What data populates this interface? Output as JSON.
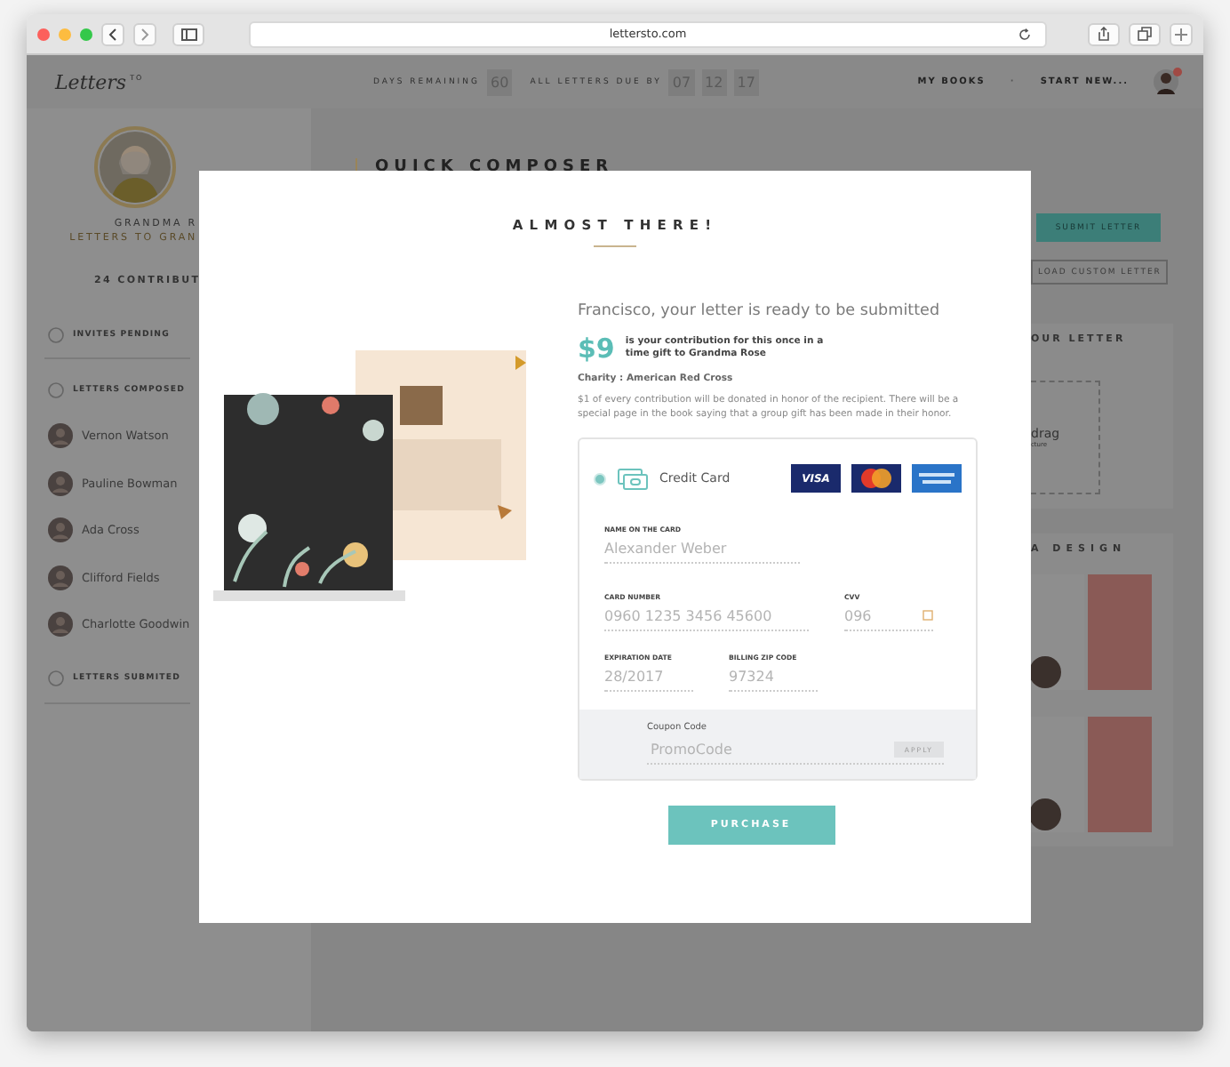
{
  "browser": {
    "url": "lettersto.com"
  },
  "header": {
    "logo": "Letters",
    "logo_suffix": "TO",
    "days_label": "DAYS REMAINING",
    "days": "60",
    "due_label": "ALL LETTERS DUE BY",
    "due": [
      "07",
      "12",
      "17"
    ],
    "nav": [
      "MY BOOKS",
      "·",
      "START NEW..."
    ]
  },
  "sidebar": {
    "name": "GRANDMA R",
    "subtitle": "LETTERS TO GRAN",
    "contributors": "24 CONTRIBUT",
    "sections": [
      {
        "label": "INVITES PENDING",
        "expanded": false
      },
      {
        "label": "LETTERS COMPOSED",
        "expanded": true,
        "children": [
          "Vernon Watson",
          "Pauline Bowman",
          "Ada Cross",
          "Clifford Fields",
          "Charlotte Goodwin"
        ]
      },
      {
        "label": "LETTERS SUBMITED",
        "expanded": false
      }
    ]
  },
  "composer": {
    "title": "QUICK COMPOSER"
  },
  "right_panel": {
    "submit": "SUBMIT LETTER",
    "load": "LOAD CUSTOM LETTER",
    "letter_title": "OUR LETTER",
    "drag_title": "drag",
    "drag_hint": "cture",
    "design_title": "A DESIGN"
  },
  "modal": {
    "title": "ALMOST THERE!",
    "heading": "Francisco, your letter is ready to be submitted",
    "amount": "$9",
    "amount_text": "is your contribution for this once in a time gift to Grandma Rose",
    "charity": "Charity : American Red Cross",
    "note": "$1 of every contribution will be donated in honor of the recipient. There will be a special page in the book saying that a group gift has been made in their honor.",
    "payment": {
      "method": "Credit Card",
      "selected": true,
      "brand": "VISA",
      "fields": [
        {
          "label": "NAME ON THE CARD",
          "placeholder": "Alexander Weber",
          "kind": "wide"
        },
        {
          "label": "CARD NUMBER",
          "placeholder": "0960 1235 3456 45600",
          "kind": "wide"
        },
        {
          "label": "CVV",
          "placeholder": "096",
          "kind": "cvv"
        },
        {
          "label": "EXPIRATION DATE",
          "placeholder": "28/2017",
          "kind": "half"
        },
        {
          "label": "BILLING ZIP CODE",
          "placeholder": "97324",
          "kind": "half"
        }
      ],
      "coupon": {
        "label": "Coupon Code",
        "placeholder": "PromoCode",
        "button": "APPLY"
      }
    },
    "purchase": "PURCHASE"
  }
}
